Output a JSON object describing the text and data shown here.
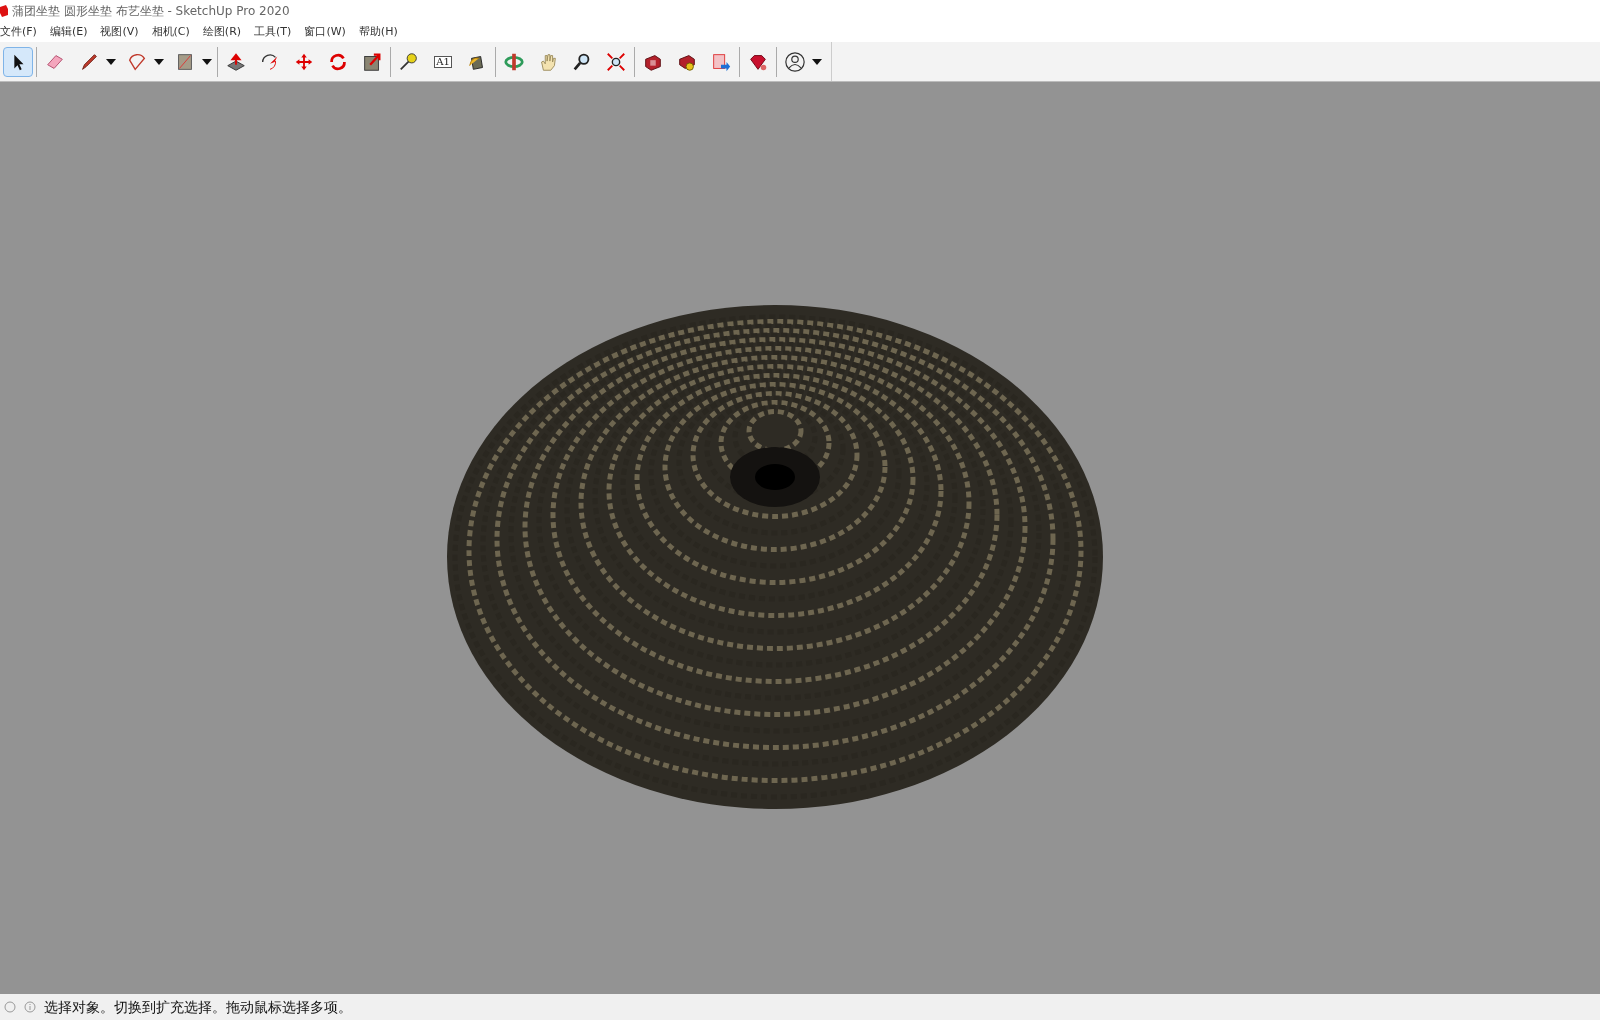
{
  "window": {
    "title": "蒲团坐垫 圆形坐垫 布艺坐垫 - SketchUp Pro 2020"
  },
  "menu": [
    "文件(F)",
    "编辑(E)",
    "视图(V)",
    "相机(C)",
    "绘图(R)",
    "工具(T)",
    "窗口(W)",
    "帮助(H)"
  ],
  "toolbar": [
    [
      {
        "kind": "select",
        "selected": true,
        "dropdown": false
      }
    ],
    [
      {
        "kind": "eraser",
        "selected": false,
        "dropdown": false
      },
      {
        "kind": "pencil",
        "selected": false,
        "dropdown": true
      },
      {
        "kind": "arc",
        "selected": false,
        "dropdown": true
      },
      {
        "kind": "rectangle",
        "selected": false,
        "dropdown": true
      }
    ],
    [
      {
        "kind": "pushpull",
        "selected": false,
        "dropdown": false
      },
      {
        "kind": "followme",
        "selected": false,
        "dropdown": false
      },
      {
        "kind": "move",
        "selected": false,
        "dropdown": false
      },
      {
        "kind": "rotate",
        "selected": false,
        "dropdown": false
      },
      {
        "kind": "scale",
        "selected": false,
        "dropdown": false
      }
    ],
    [
      {
        "kind": "tape",
        "selected": false,
        "dropdown": false
      },
      {
        "kind": "text",
        "label": "A1",
        "selected": false,
        "dropdown": false
      },
      {
        "kind": "paint",
        "selected": false,
        "dropdown": false
      }
    ],
    [
      {
        "kind": "orbit",
        "selected": false,
        "dropdown": false
      },
      {
        "kind": "pan",
        "selected": false,
        "dropdown": false
      },
      {
        "kind": "zoom",
        "selected": false,
        "dropdown": false
      },
      {
        "kind": "extents",
        "selected": false,
        "dropdown": false
      }
    ],
    [
      {
        "kind": "warehouse",
        "selected": false,
        "dropdown": false
      },
      {
        "kind": "extensions",
        "selected": false,
        "dropdown": false
      },
      {
        "kind": "send",
        "selected": false,
        "dropdown": false
      }
    ],
    [
      {
        "kind": "ruby",
        "selected": false,
        "dropdown": false
      }
    ],
    [
      {
        "kind": "account",
        "selected": false,
        "dropdown": true
      }
    ]
  ],
  "status_bar": {
    "message": "选择对象。切换到扩充选择。拖动鼠标选择多项。"
  }
}
